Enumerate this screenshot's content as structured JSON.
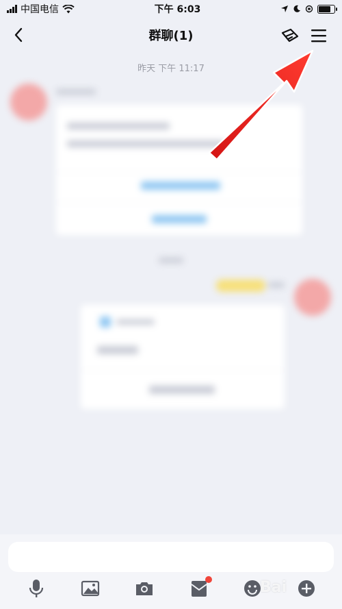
{
  "status_bar": {
    "carrier": "中国电信",
    "time": "下午 6:03"
  },
  "header": {
    "title": "群聊(1)"
  },
  "chat": {
    "timestamp": "昨天 下午 11:17"
  },
  "watermark": "Bai"
}
